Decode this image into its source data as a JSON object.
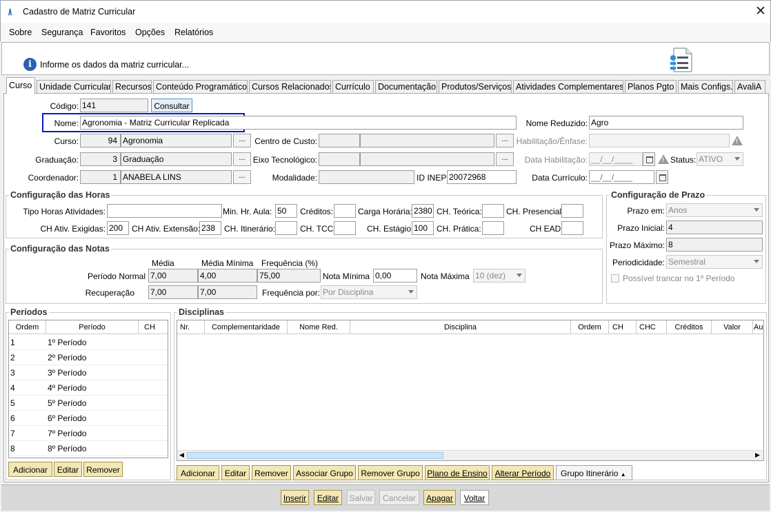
{
  "window": {
    "title": "Cadastro de Matriz Curricular",
    "app_glyph": "/\\"
  },
  "menu": [
    "Sobre",
    "Segurança",
    "Favoritos",
    "Opções",
    "Relatórios"
  ],
  "info": {
    "text": "Informe os dados da matriz curricular..."
  },
  "tabs": [
    "Curso",
    "Unidade Curricular",
    "Recursos",
    "Conteúdo Programático",
    "Cursos Relacionados",
    "Currículo",
    "Documentação",
    "Produtos/Serviços",
    "Atividades Complementares",
    "Planos Pgto",
    "Mais Configs.",
    "AvaliA"
  ],
  "form": {
    "codigo_label": "Código:",
    "codigo": "141",
    "consultar": "Consultar",
    "nome_label": "Nome:",
    "nome": "Agronomia - Matriz Curricular Replicada",
    "nome_reduzido_label": "Nome Reduzido:",
    "nome_reduzido": "Agro",
    "curso_label": "Curso:",
    "curso_id": "94",
    "curso_nome": "Agronomia",
    "centro_custo_label": "Centro de Custo:",
    "habilitacao_label": "Habilitação/Ênfase:",
    "graduacao_label": "Graduação:",
    "graduacao_id": "3",
    "graduacao_nome": "Graduação",
    "eixo_label": "Eixo Tecnológico:",
    "data_habilitacao_label": "Data Habilitação:",
    "data_placeholder": "__/__/____",
    "status_label": "Status:",
    "status": "ATIVO",
    "coordenador_label": "Coordenador:",
    "coordenador_id": "1",
    "coordenador_nome": "ANABELA LINS",
    "modalidade_label": "Modalidade:",
    "id_inep_label": "ID INEP:",
    "id_inep": "20072968",
    "data_curriculo_label": "Data Currículo:",
    "dots": "..."
  },
  "horas": {
    "title": "Configuração das Horas",
    "tipo_horas_label": "Tipo Horas Atividades:",
    "min_hr_aula_label": "Min. Hr. Aula:",
    "min_hr_aula": "50",
    "creditos_label": "Créditos:",
    "carga_horaria_label": "Carga Horária:",
    "carga_horaria": "2380",
    "ch_teorica_label": "CH. Teórica:",
    "ch_presencial_label": "CH. Presencial:",
    "ch_ativ_exigidas_label": "CH Ativ. Exigidas:",
    "ch_ativ_exigidas": "200",
    "ch_ativ_extensao_label": "CH Ativ. Extensão:",
    "ch_ativ_extensao": "238",
    "ch_itinerario_label": "CH. Itinerário:",
    "ch_tcc_label": "CH. TCC:",
    "ch_estagio_label": "CH. Estágio:",
    "ch_estagio": "100",
    "ch_pratica_label": "CH. Prática:",
    "ch_ead_label": "CH EAD:"
  },
  "prazo": {
    "title": "Configuração de Prazo",
    "prazo_em_label": "Prazo em:",
    "prazo_em": "Anos",
    "prazo_inicial_label": "Prazo Inicial:",
    "prazo_inicial": "4",
    "prazo_maximo_label": "Prazo Máximo:",
    "prazo_maximo": "8",
    "periodicidade_label": "Periodicidade:",
    "periodicidade": "Semestral",
    "trancar_label": "Possível trancar no 1º Período"
  },
  "notas": {
    "title": "Configuração das Notas",
    "media_header": "Média",
    "media_minima_header": "Média Mínima",
    "frequencia_header": "Frequência (%)",
    "periodo_normal_label": "Período Normal",
    "pn_media": "7,00",
    "pn_media_minima": "4,00",
    "pn_frequencia": "75,00",
    "nota_minima_label": "Nota Mínima",
    "nota_minima": "0,00",
    "nota_maxima_label": "Nota Máxima",
    "nota_maxima": "10 (dez)",
    "recuperacao_label": "Recuperação",
    "rec_media": "7,00",
    "rec_media_minima": "7,00",
    "frequencia_por_label": "Frequência por:",
    "frequencia_por": "Por Disciplina"
  },
  "periodos": {
    "title": "Períodos",
    "headers": [
      "Ordem",
      "Período",
      "CH"
    ],
    "rows": [
      {
        "ordem": "1",
        "periodo": "1º Período"
      },
      {
        "ordem": "2",
        "periodo": "2º Período"
      },
      {
        "ordem": "3",
        "periodo": "3º Período"
      },
      {
        "ordem": "4",
        "periodo": "4º Período"
      },
      {
        "ordem": "5",
        "periodo": "5º Período"
      },
      {
        "ordem": "6",
        "periodo": "6º Período"
      },
      {
        "ordem": "7",
        "periodo": "7º Período"
      },
      {
        "ordem": "8",
        "periodo": "8º Período"
      }
    ],
    "buttons": [
      "Adicionar",
      "Editar",
      "Remover"
    ]
  },
  "disciplinas": {
    "title": "Disciplinas",
    "headers": [
      "Nr.",
      "Complementaridade",
      "Nome Red.",
      "Disciplina",
      "Ordem",
      "CH",
      "CHC",
      "Créditos",
      "Valor",
      "Au"
    ],
    "buttons": [
      "Adicionar",
      "Editar",
      "Remover",
      "Associar Grupo",
      "Remover Grupo",
      "Plano de Ensino",
      "Alterar Período"
    ],
    "grupo_itinerario": "Grupo Itinerário"
  },
  "footer": {
    "buttons": [
      "Inserir",
      "Editar",
      "Salvar",
      "Cancelar",
      "Apagar",
      "Voltar"
    ]
  },
  "colors": {
    "highlight": "#0a17c9",
    "button_yellow": "#f3e8b4",
    "info_blue": "#2860b4"
  }
}
